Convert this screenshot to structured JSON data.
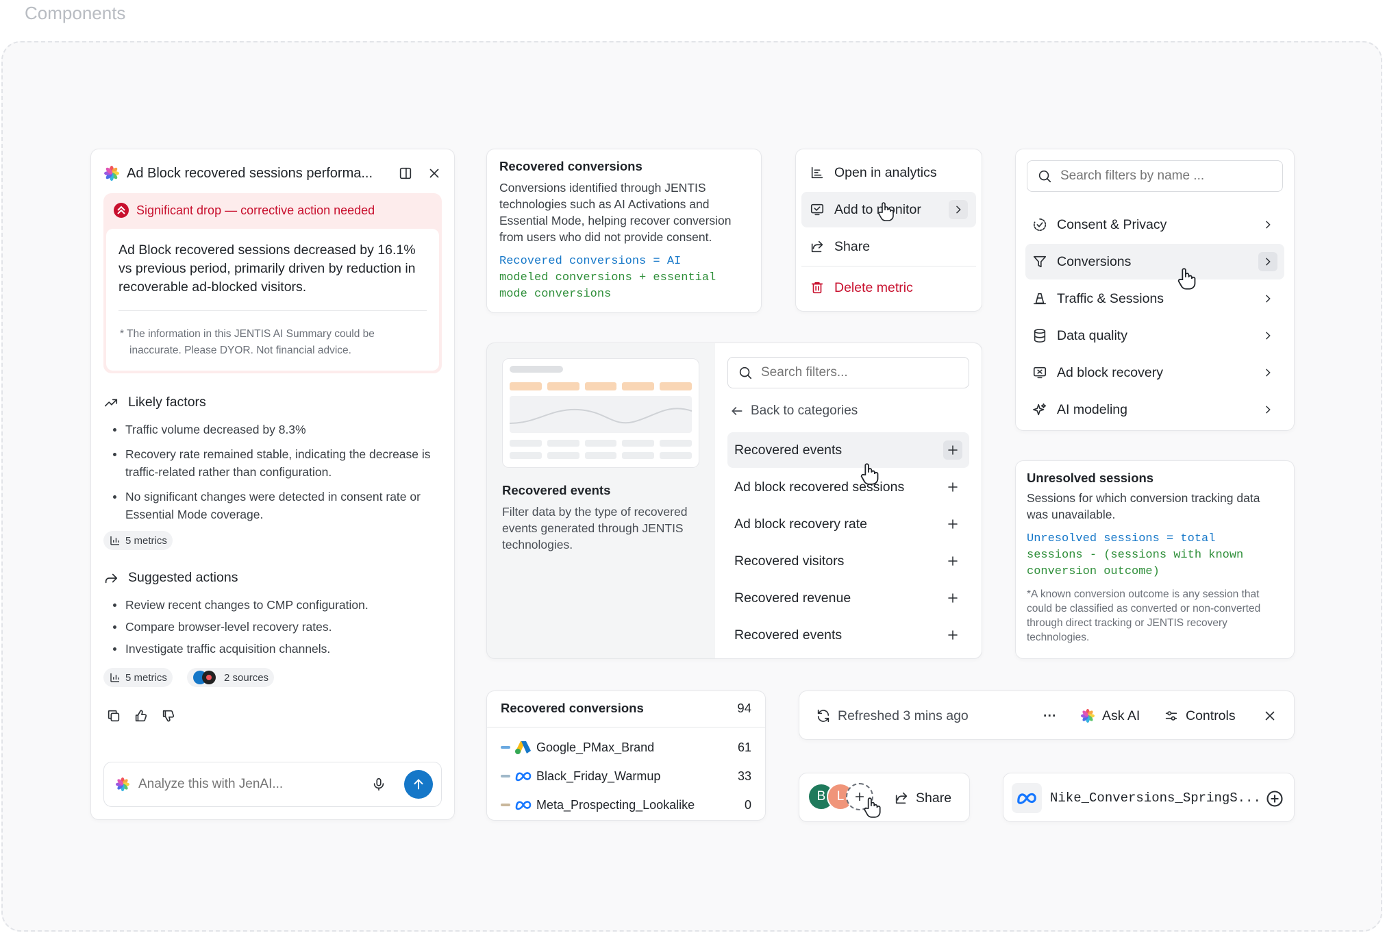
{
  "page": {
    "title": "Components"
  },
  "ai_panel": {
    "title": "Ad Block recovered sessions performa...",
    "alert": "Significant drop — corrective action needed",
    "summary": "Ad Block recovered sessions decreased by 16.1% vs previous period, primarily driven by reduction in recoverable ad-blocked visitors.",
    "disclaimer": "* The information in this JENTIS AI Summary could be inaccurate. Please DYOR. Not financial advice.",
    "factors_title": "Likely factors",
    "factors": [
      "Traffic volume decreased by 8.3%",
      "Recovery rate remained stable, indicating the decrease is traffic-related rather than configuration.",
      "No significant changes were detected in consent rate or Essential Mode coverage."
    ],
    "factors_chip": "5 metrics",
    "actions_title": "Suggested actions",
    "actions": [
      "Review recent changes to CMP configuration.",
      "Compare browser-level recovery rates.",
      "Investigate traffic acquisition channels."
    ],
    "actions_chip_metrics": "5 metrics",
    "actions_chip_sources": "2 sources",
    "input_placeholder": "Analyze this with JenAI..."
  },
  "tooltip_conversions": {
    "title": "Recovered conversions",
    "desc": "Conversions identified through JENTIS technologies such as AI Activations and Essential Mode, helping recover conversion from users who did not provide consent.",
    "formula_1": "Recovered conversions = AI",
    "formula_2": "modeled conversions + essential",
    "formula_3": "mode conversions"
  },
  "context_menu": {
    "items": [
      "Open in analytics",
      "Add to monitor",
      "Share"
    ],
    "delete": "Delete metric"
  },
  "filter_categories": {
    "search_placeholder": "Search filters by name ...",
    "items": [
      "Consent & Privacy",
      "Conversions",
      "Traffic & Sessions",
      "Data quality",
      "Ad block recovery",
      "AI modeling"
    ]
  },
  "recovered_events": {
    "preview_title": "Recovered events",
    "preview_desc": "Filter data by the type of recovered events generated through JENTIS technologies.",
    "search_placeholder": "Search filters...",
    "back": "Back to categories",
    "items": [
      "Recovered events",
      "Ad block recovered sessions",
      "Ad block recovery rate",
      "Recovered visitors",
      "Recovered revenue",
      "Recovered events"
    ]
  },
  "tooltip_unresolved": {
    "title": "Unresolved sessions",
    "desc": "Sessions for which conversion tracking data was unavailable.",
    "formula_1": "Unresolved sessions = total",
    "formula_2": "sessions - (sessions with known",
    "formula_3": "conversion outcome)",
    "note": "*A known conversion outcome is any session that could be classified as converted or non-converted through direct tracking or JENTIS recovery technologies."
  },
  "conversions_table": {
    "title": "Recovered conversions",
    "total": "94",
    "rows": [
      {
        "name": "Google_PMax_Brand",
        "value": "61",
        "color": "#6aa9e0"
      },
      {
        "name": "Black_Friday_Warmup",
        "value": "33",
        "color": "#9fb8c9"
      },
      {
        "name": "Meta_Prospecting_Lookalike",
        "value": "0",
        "color": "#c9b79b"
      }
    ]
  },
  "toolbar": {
    "refreshed": "Refreshed 3 mins ago",
    "more": "···",
    "ask_ai": "Ask AI",
    "controls": "Controls"
  },
  "share_bar": {
    "avatars": [
      "B",
      "L"
    ],
    "share": "Share"
  },
  "campaign_chip": {
    "name": "Nike_Conversions_SpringS..."
  },
  "colors": {
    "accent": "#1577c8",
    "danger": "#c8102e",
    "formula_green": "#2f8f3a"
  }
}
